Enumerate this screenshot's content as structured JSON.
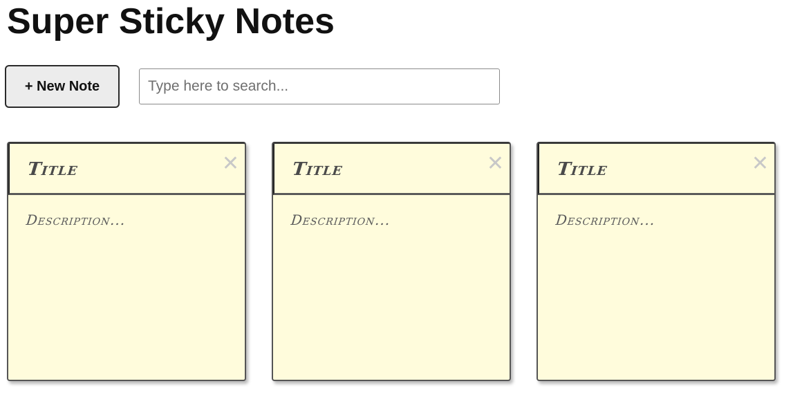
{
  "app": {
    "title": "Super Sticky Notes"
  },
  "toolbar": {
    "new_note_label": "+ New Note",
    "search_placeholder": "Type here to search...",
    "search_value": ""
  },
  "notes": [
    {
      "title": "Title",
      "description": "Description...",
      "close_icon": "close-icon"
    },
    {
      "title": "Title",
      "description": "Description...",
      "close_icon": "close-icon"
    },
    {
      "title": "Title",
      "description": "Description...",
      "close_icon": "close-icon"
    }
  ],
  "colors": {
    "note_background": "#fffcdc",
    "note_border": "#555555",
    "close_icon": "#c8c8c8",
    "button_background": "#ececec"
  }
}
